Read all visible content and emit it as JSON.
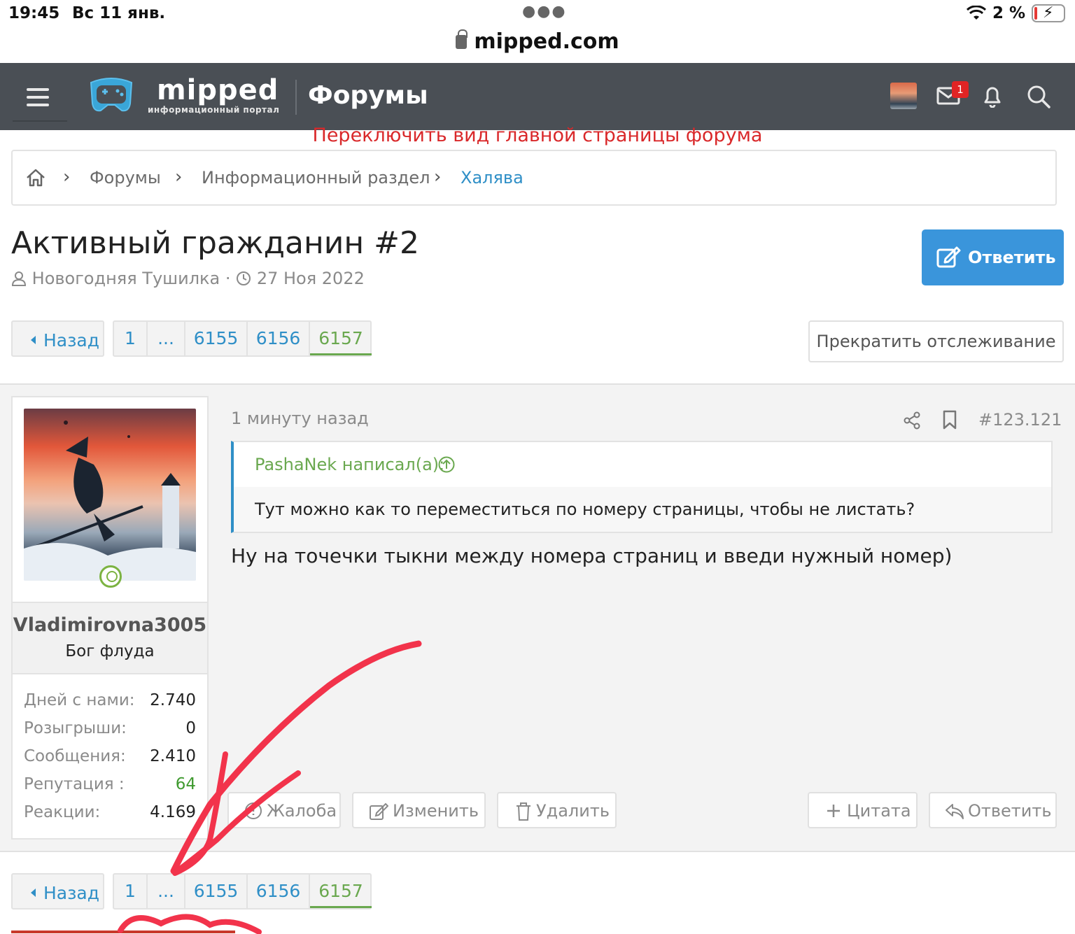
{
  "status_bar": {
    "time": "19:45",
    "date": "Вс 11 янв.",
    "battery": "2 %",
    "url": "mipped.com"
  },
  "header": {
    "logo_text": "mipped",
    "logo_subtitle": "информационный портал",
    "section_title": "Форумы",
    "mail_badge": "1"
  },
  "switch_view_link": "Переключить вид главной страницы форума",
  "breadcrumbs": [
    "Форумы",
    "Информационный раздел",
    "Халява"
  ],
  "thread": {
    "title": "Активный гражданин #2",
    "author": "Новогодняя Тушилка",
    "date": "27 Ноя 2022",
    "reply_button": "Ответить",
    "unwatch_button": "Прекратить отслеживание"
  },
  "pagination": {
    "back_label": "Назад",
    "pages": [
      "1",
      "...",
      "6155",
      "6156",
      "6157"
    ],
    "current": "6157"
  },
  "post": {
    "time": "1 минуту назад",
    "number": "#123.121",
    "user": {
      "name": "Vladimirovna3005",
      "title": "Бог флуда",
      "stats": [
        {
          "label": "Дней с нами:",
          "value": "2.740"
        },
        {
          "label": "Розыгрыши:",
          "value": "0"
        },
        {
          "label": "Сообщения:",
          "value": "2.410"
        },
        {
          "label": "Репутация :",
          "value": "64"
        },
        {
          "label": "Реакции:",
          "value": "4.169"
        }
      ]
    },
    "quote": {
      "author": "PashaNek написал(а):",
      "text": "Тут можно как то переместиться по номеру страницы, чтобы не листать?"
    },
    "body": "Ну на точечки тыкни между номера страниц и введи нужный номер)",
    "actions": {
      "report": "Жалоба",
      "edit": "Изменить",
      "delete": "Удалить",
      "quote": "Цитата",
      "reply": "Ответить"
    }
  },
  "colors": {
    "header_bg": "#4a4f55",
    "link": "#2f8fc7",
    "accent_green": "#6aa84f",
    "primary_button": "#3a95db",
    "annotation": "#f2334b"
  }
}
